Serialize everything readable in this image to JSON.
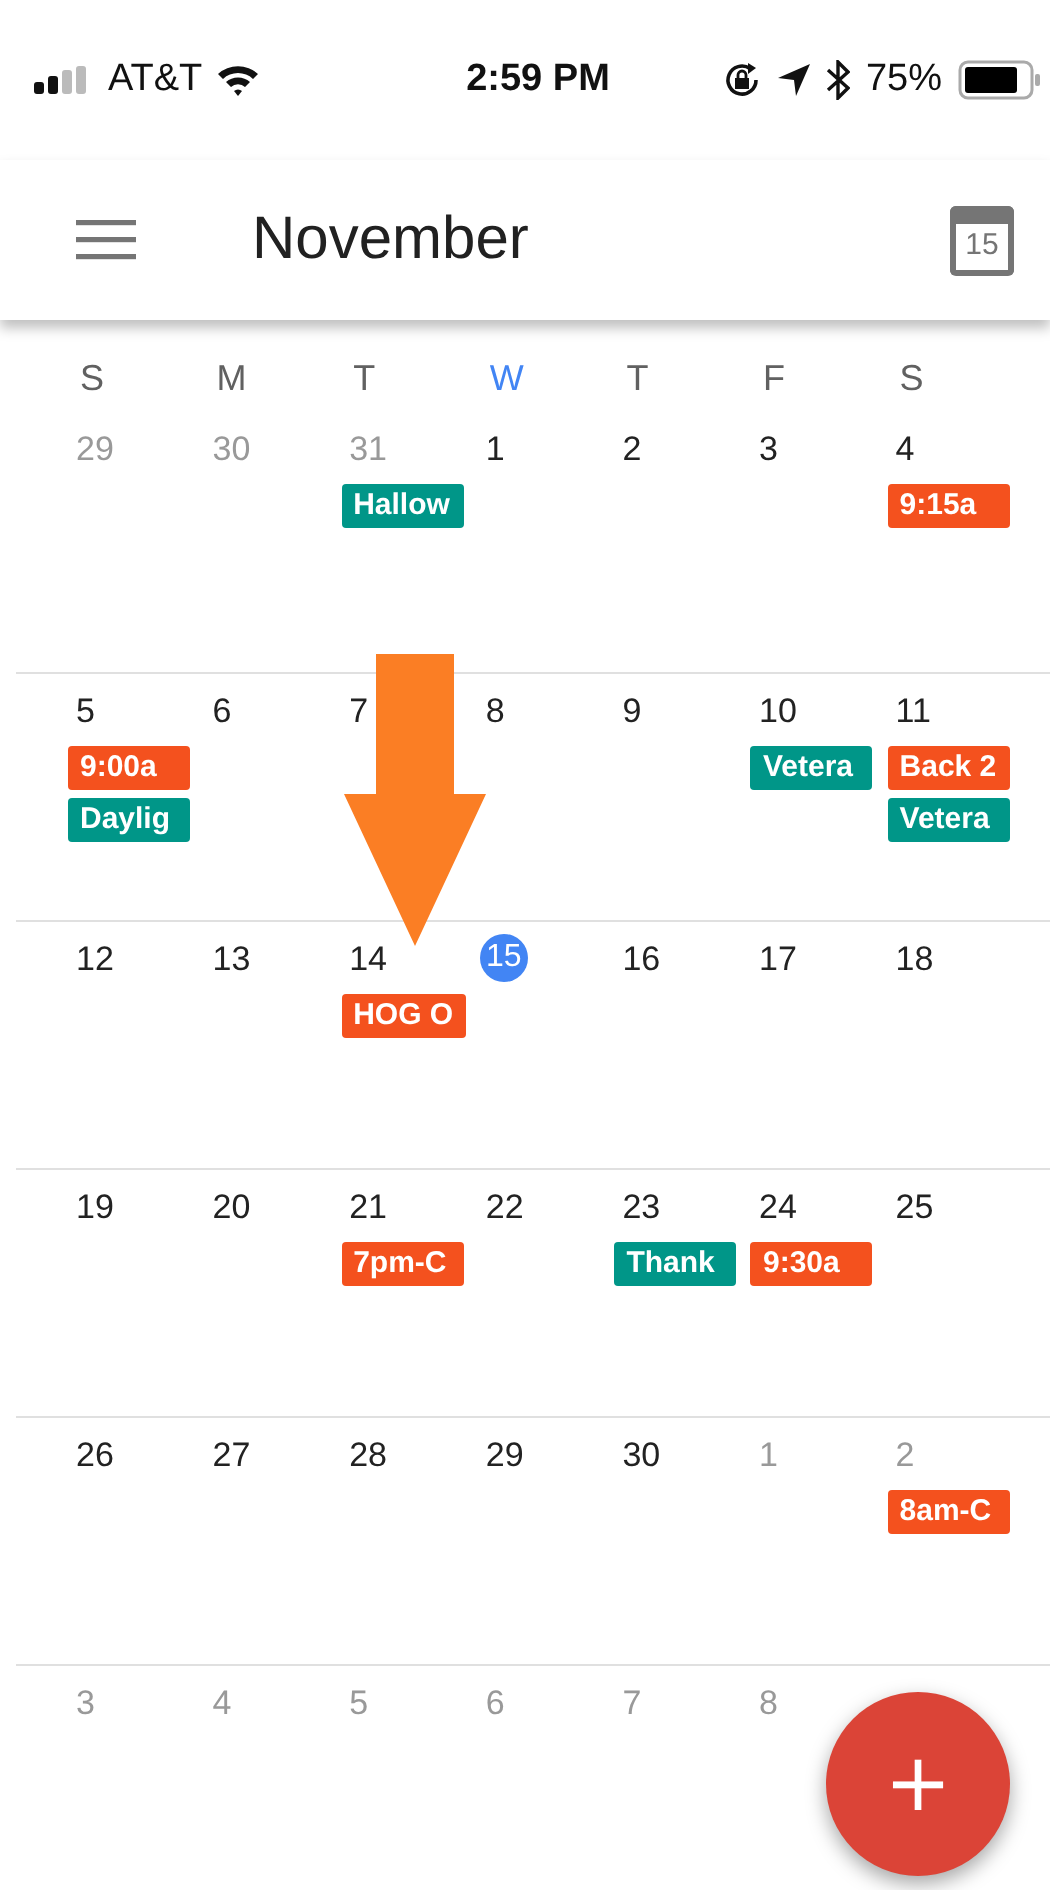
{
  "status_bar": {
    "carrier": "AT&T",
    "time": "2:59 PM",
    "battery": "75%"
  },
  "app_bar": {
    "title": "November",
    "today_icon": "15"
  },
  "weekdays": [
    {
      "label": "S",
      "selected": false
    },
    {
      "label": "M",
      "selected": false
    },
    {
      "label": "T",
      "selected": false
    },
    {
      "label": "W",
      "selected": true
    },
    {
      "label": "T",
      "selected": false
    },
    {
      "label": "F",
      "selected": false
    },
    {
      "label": "S",
      "selected": false
    }
  ],
  "weeks": [
    [
      {
        "day": "29",
        "muted": true,
        "today": false
      },
      {
        "day": "30",
        "muted": true,
        "today": false
      },
      {
        "day": "31",
        "muted": true,
        "today": false,
        "events": [
          {
            "label": "Hallow",
            "color": "#009688"
          }
        ]
      },
      {
        "day": "1",
        "muted": false,
        "today": false
      },
      {
        "day": "2",
        "muted": false,
        "today": false
      },
      {
        "day": "3",
        "muted": false,
        "today": false
      },
      {
        "day": "4",
        "muted": false,
        "today": false,
        "events": [
          {
            "label": "9:15a",
            "color": "#f4511e"
          }
        ]
      }
    ],
    [
      {
        "day": "5",
        "muted": false,
        "today": false,
        "events": [
          {
            "label": "9:00a",
            "color": "#f4511e"
          },
          {
            "label": "Daylig",
            "color": "#009688"
          }
        ]
      },
      {
        "day": "6",
        "muted": false,
        "today": false
      },
      {
        "day": "7",
        "muted": false,
        "today": false
      },
      {
        "day": "8",
        "muted": false,
        "today": false
      },
      {
        "day": "9",
        "muted": false,
        "today": false
      },
      {
        "day": "10",
        "muted": false,
        "today": false,
        "events": [
          {
            "label": "Vetera",
            "color": "#009688"
          }
        ]
      },
      {
        "day": "11",
        "muted": false,
        "today": false,
        "events": [
          {
            "label": "Back 2",
            "color": "#f4511e"
          },
          {
            "label": "Vetera",
            "color": "#009688"
          }
        ]
      }
    ],
    [
      {
        "day": "12",
        "muted": false,
        "today": false
      },
      {
        "day": "13",
        "muted": false,
        "today": false
      },
      {
        "day": "14",
        "muted": false,
        "today": false,
        "events": [
          {
            "label": "HOG O",
            "color": "#f4511e"
          }
        ]
      },
      {
        "day": "15",
        "muted": false,
        "today": true
      },
      {
        "day": "16",
        "muted": false,
        "today": false
      },
      {
        "day": "17",
        "muted": false,
        "today": false
      },
      {
        "day": "18",
        "muted": false,
        "today": false
      }
    ],
    [
      {
        "day": "19",
        "muted": false,
        "today": false
      },
      {
        "day": "20",
        "muted": false,
        "today": false
      },
      {
        "day": "21",
        "muted": false,
        "today": false,
        "events": [
          {
            "label": "7pm-C",
            "color": "#f4511e"
          }
        ]
      },
      {
        "day": "22",
        "muted": false,
        "today": false
      },
      {
        "day": "23",
        "muted": false,
        "today": false,
        "events": [
          {
            "label": "Thank",
            "color": "#009688"
          }
        ]
      },
      {
        "day": "24",
        "muted": false,
        "today": false,
        "events": [
          {
            "label": "9:30a",
            "color": "#f4511e"
          }
        ]
      },
      {
        "day": "25",
        "muted": false,
        "today": false
      }
    ],
    [
      {
        "day": "26",
        "muted": false,
        "today": false
      },
      {
        "day": "27",
        "muted": false,
        "today": false
      },
      {
        "day": "28",
        "muted": false,
        "today": false
      },
      {
        "day": "29",
        "muted": false,
        "today": false
      },
      {
        "day": "30",
        "muted": false,
        "today": false
      },
      {
        "day": "1",
        "muted": true,
        "today": false
      },
      {
        "day": "2",
        "muted": true,
        "today": false,
        "events": [
          {
            "label": "8am-C",
            "color": "#f4511e"
          }
        ]
      }
    ],
    [
      {
        "day": "3",
        "muted": true,
        "today": false
      },
      {
        "day": "4",
        "muted": true,
        "today": false
      },
      {
        "day": "5",
        "muted": true,
        "today": false
      },
      {
        "day": "6",
        "muted": true,
        "today": false
      },
      {
        "day": "7",
        "muted": true,
        "today": false
      },
      {
        "day": "8",
        "muted": true,
        "today": false
      }
    ]
  ],
  "fab": {
    "label": "+"
  }
}
